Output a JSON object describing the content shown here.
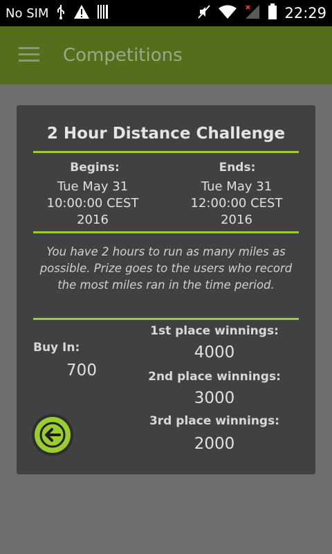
{
  "status_bar": {
    "carrier": "No SIM",
    "time": "22:29"
  },
  "app_bar": {
    "title": "Competitions"
  },
  "competition": {
    "title": "2 Hour Distance Challenge",
    "begins_label": "Begins:",
    "begins_lines": [
      "Tue May 31",
      "10:00:00 CEST",
      "2016"
    ],
    "ends_label": "Ends:",
    "ends_lines": [
      "Tue May 31",
      "12:00:00 CEST",
      "2016"
    ],
    "description": "You have 2 hours to run as many miles as possible. Prize goes to the users who record the most miles ran in the time period.",
    "buy_in_label": "Buy In:",
    "buy_in_value": "700",
    "prizes": [
      {
        "label": "1st place winnings:",
        "value": "4000"
      },
      {
        "label": "2nd place winnings:",
        "value": "3000"
      },
      {
        "label": "3rd place winnings:",
        "value": "2000"
      }
    ]
  },
  "colors": {
    "app_bar": "#536f1c",
    "accent": "#9acd32",
    "card": "#414141",
    "background": "#6e6e6e"
  },
  "icons": [
    "usb-icon",
    "warning-icon",
    "barcode-icon",
    "mute-icon",
    "wifi-icon",
    "signal-icon",
    "battery-icon",
    "menu-icon",
    "back-arrow-icon"
  ]
}
